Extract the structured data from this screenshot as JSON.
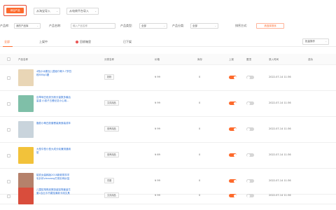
{
  "toolbar": {
    "new_product": "添加产品",
    "import_1688": "从淘宝导入",
    "import_platform": "从电商平台导入"
  },
  "filters": {
    "type_label": "产品库:",
    "type_value": "我的产品库",
    "name_label": "产品名称:",
    "name_placeholder": "输入产品名称",
    "model_label": "产品类型:",
    "model_value": "全部",
    "category_label": "产品分类:",
    "category_value": "全部",
    "sort_label": "排序方式:",
    "sort_value": "请选择排序"
  },
  "tabs": [
    {
      "label": "全部"
    },
    {
      "label": "上架中"
    },
    {
      "label": "回收箱里"
    },
    {
      "label": "已下架"
    }
  ],
  "warn_symbol": "!",
  "batch_action": "批量操作",
  "table": {
    "headers": [
      "产品名称",
      "分类名称",
      "价格",
      "库存",
      "上架",
      "置顶",
      "录入时间",
      "选功"
    ],
    "rows": [
      {
        "name": "4瓶小冰霸瓦儿童纸巾粉3-7岁四段800g1罐",
        "category": "奶粉",
        "price": "¥ 99",
        "stock": "0",
        "online": true,
        "pinned": false,
        "time": "2022-07-14 11:36",
        "thumb": "#e9d6b6"
      },
      {
        "name": "百草味白色荧光粉分量数多最后量重 小孩子五餐纪念小心用...",
        "category": "文具用品",
        "price": "¥ 99",
        "stock": "0",
        "online": true,
        "pinned": false,
        "time": "2022-07-14 11:36",
        "thumb": "#7fbfa8"
      },
      {
        "name": "脂肪小萌白胶套餐装美食装成年",
        "category": "营养用品",
        "price": "¥ 99",
        "stock": "0",
        "online": true,
        "pinned": false,
        "time": "2022-07-14 11:36",
        "thumb": "#c9d4dc"
      },
      {
        "name": "大型中型小型大成分幼兼测通用型",
        "category": "营养用品",
        "price": "¥ 69",
        "stock": "0",
        "online": true,
        "pinned": false,
        "time": "2022-07-14 11:36",
        "thumb": "#f2c23a"
      },
      {
        "name": "韬初女装韩版2018新款带扣羊毛针织vlanzang打底衫网纱复",
        "category": "衣服",
        "price": "¥ 99",
        "stock": "0",
        "online": true,
        "pinned": false,
        "time": "2022-07-14 11:36",
        "thumb": "#b5816b"
      },
      {
        "name": "儿童铅笔橡皮擦游装铅笔套装牛套2合出卡不腐蚀清新卡用文具",
        "category": "文具用品",
        "price": "¥ 99",
        "stock": "0",
        "online": true,
        "pinned": false,
        "time": "2022-07-14 11:36",
        "thumb": "#d94d3c"
      }
    ]
  },
  "colors": {
    "accent": "#fd6a2c",
    "link": "#2a6fd6"
  }
}
